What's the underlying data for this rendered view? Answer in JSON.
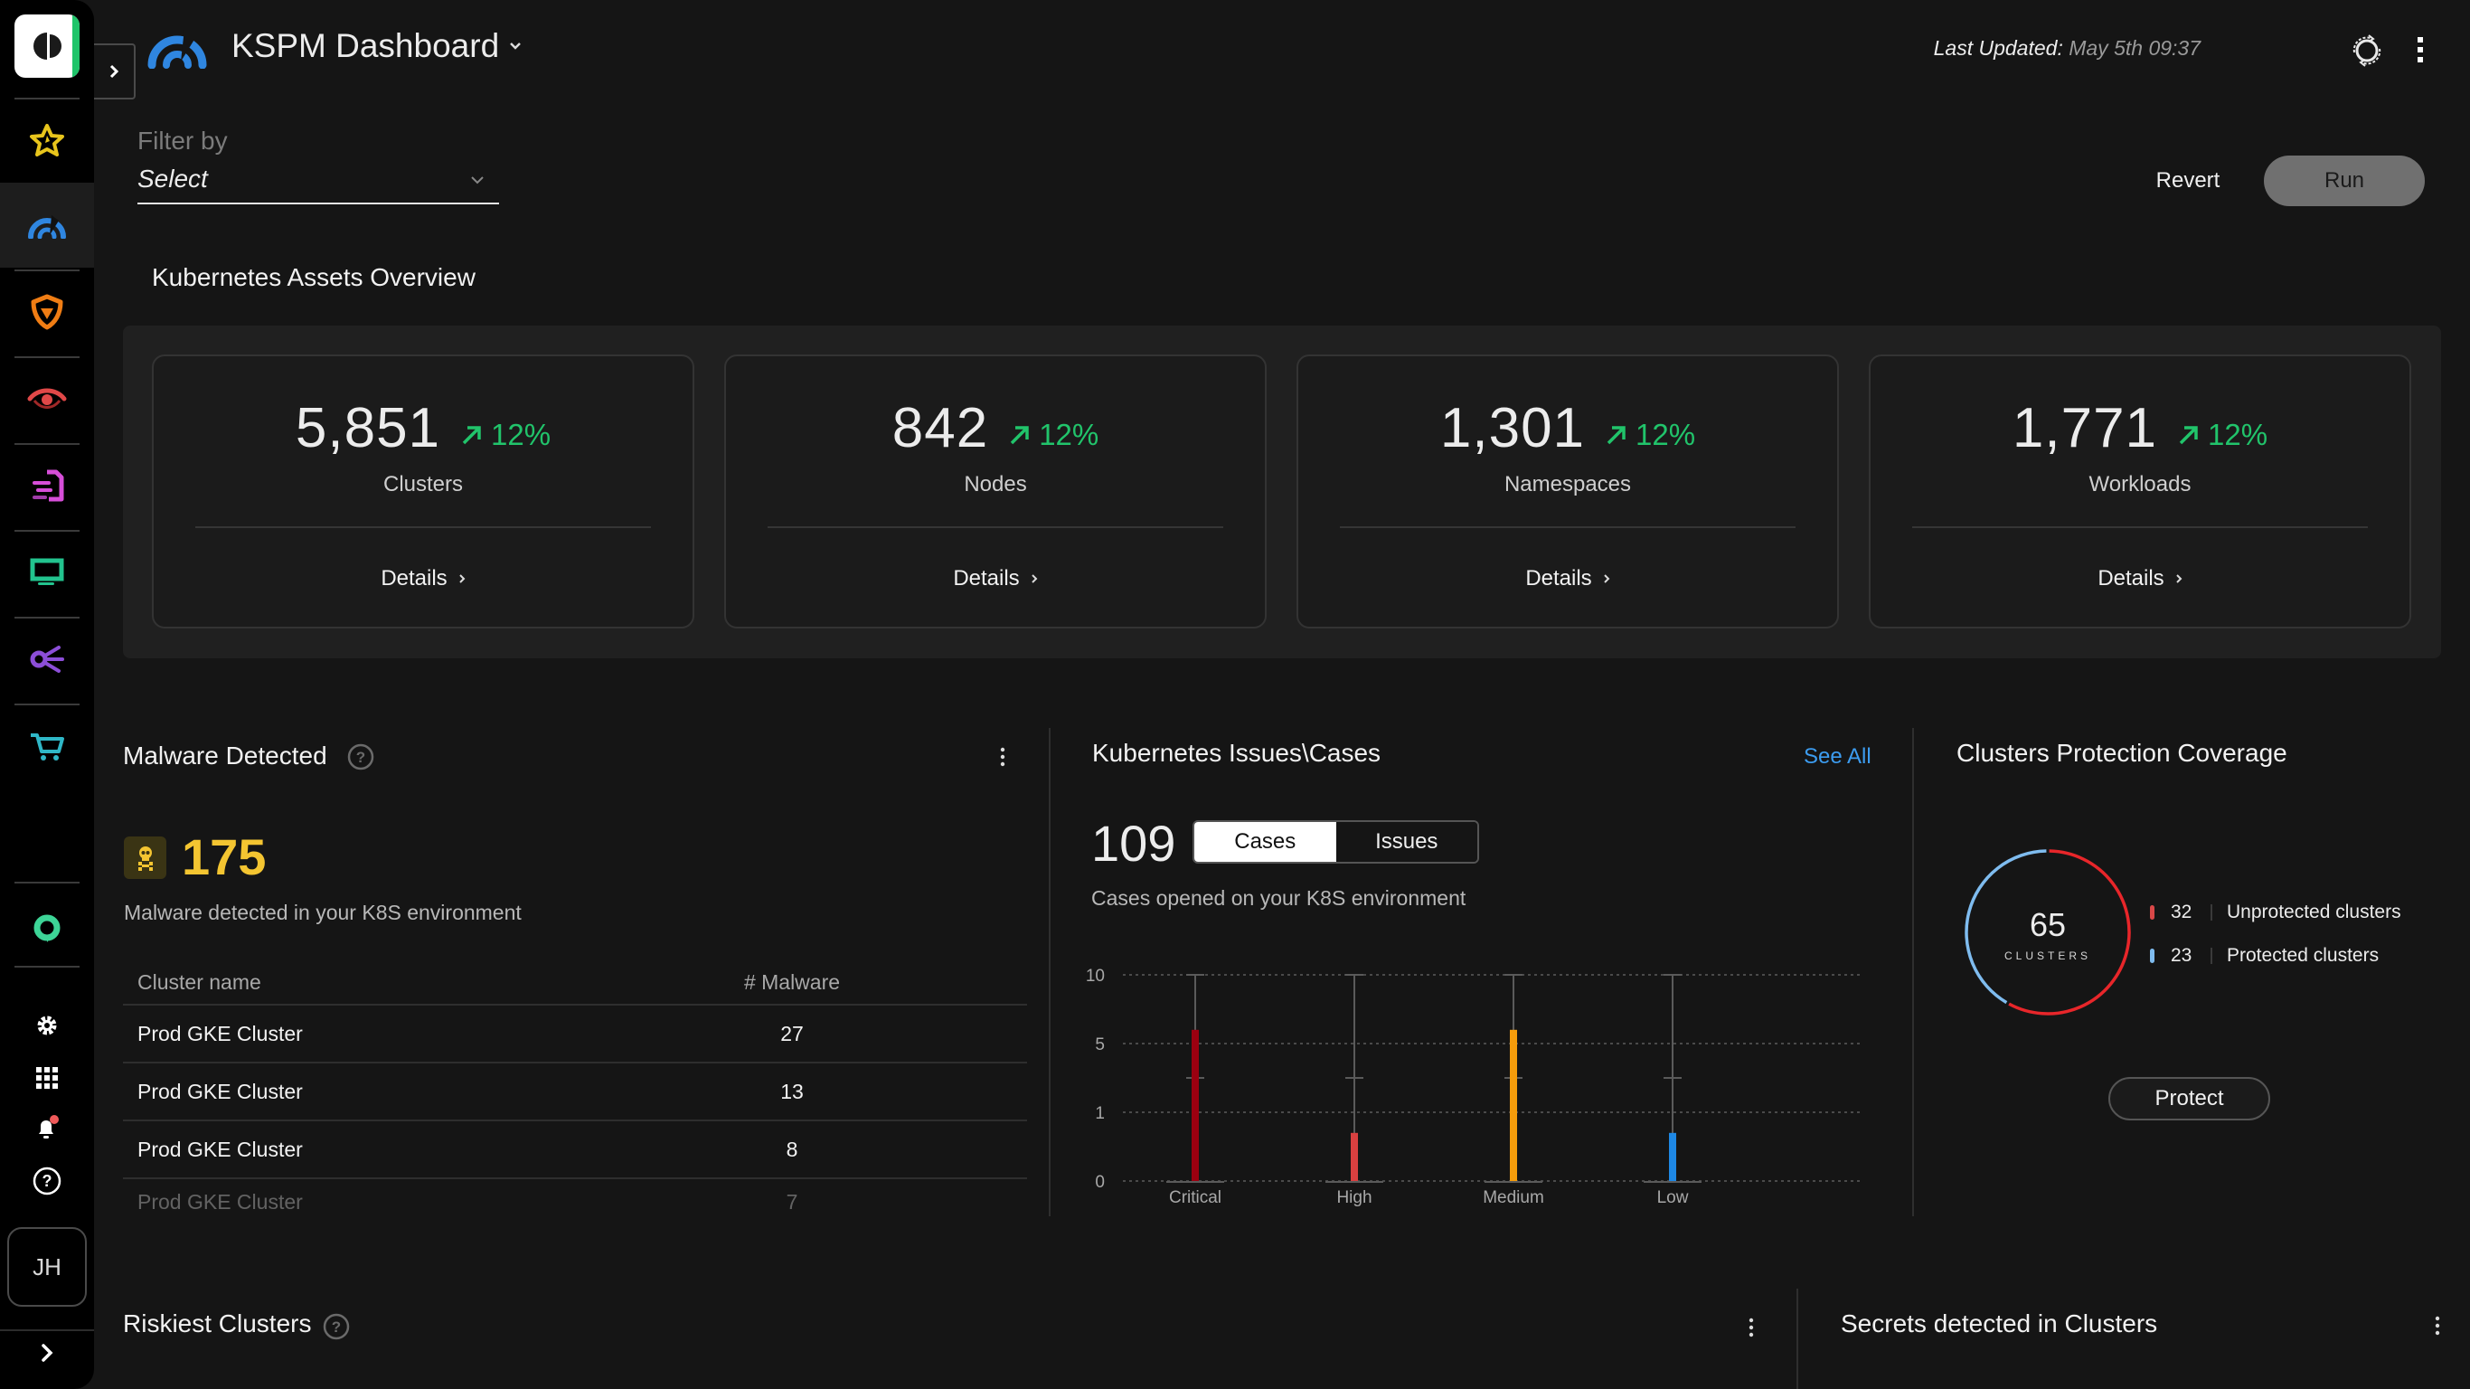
{
  "sidebar": {
    "items": [
      {
        "icon": "star-icon",
        "label": "Favorites",
        "color": "#e8c51c"
      },
      {
        "icon": "dashboard-gauge-icon",
        "label": "Dashboards",
        "color": "#2f86e0",
        "active": true
      },
      {
        "icon": "shield-icon",
        "label": "Protection",
        "color": "#f07d14"
      },
      {
        "icon": "eye-icon",
        "label": "Detection",
        "color": "#e04848"
      },
      {
        "icon": "document-icon",
        "label": "Reports",
        "color": "#d64ed8"
      },
      {
        "icon": "monitor-icon",
        "label": "Endpoints",
        "color": "#22c38e"
      },
      {
        "icon": "network-icon",
        "label": "Integrations",
        "color": "#8c4ed8"
      },
      {
        "icon": "cart-icon",
        "label": "Marketplace",
        "color": "#2fb7c7"
      }
    ],
    "avatar_initials": "JH"
  },
  "header": {
    "title": "KSPM Dashboard",
    "last_updated_label": "Last Updated:",
    "last_updated_value": "May 5th 09:37"
  },
  "filter": {
    "label": "Filter by",
    "value": "Select",
    "revert_label": "Revert",
    "run_label": "Run"
  },
  "assets": {
    "title": "Kubernetes Assets Overview",
    "cards": [
      {
        "value": "5,851",
        "trend": "12%",
        "label": "Clusters",
        "details": "Details"
      },
      {
        "value": "842",
        "trend": "12%",
        "label": "Nodes",
        "details": "Details"
      },
      {
        "value": "1,301",
        "trend": "12%",
        "label": "Namespaces",
        "details": "Details"
      },
      {
        "value": "1,771",
        "trend": "12%",
        "label": "Workloads",
        "details": "Details"
      }
    ]
  },
  "malware": {
    "title": "Malware Detected",
    "count": "175",
    "description": "Malware detected in your K8S environment",
    "columns": [
      "Cluster name",
      "# Malware"
    ],
    "rows": [
      {
        "name": "Prod GKE Cluster",
        "count": "27"
      },
      {
        "name": "Prod GKE Cluster",
        "count": "13"
      },
      {
        "name": "Prod GKE Cluster",
        "count": "8"
      },
      {
        "name": "Prod GKE Cluster",
        "count": "7"
      }
    ]
  },
  "issues": {
    "title": "Kubernetes Issues\\Cases",
    "see_all": "See All",
    "count": "109",
    "toggle": {
      "cases": "Cases",
      "issues": "Issues",
      "selected": "Cases"
    },
    "description": "Cases opened on your K8S environment"
  },
  "chart_data": {
    "type": "bar",
    "title": "Kubernetes Issues\\Cases",
    "xlabel": "",
    "ylabel": "",
    "categories": [
      "Critical",
      "High",
      "Medium",
      "Low"
    ],
    "values": [
      6,
      0.7,
      6,
      0.7
    ],
    "colors": [
      "#9b0010",
      "#d94040",
      "#f59c0b",
      "#1e88e5"
    ],
    "y_ticks": [
      0,
      1,
      5,
      10
    ],
    "y_scale": "piecewise (0,1,5,10 evenly spaced)",
    "ylim": [
      0,
      10
    ],
    "grid": true
  },
  "coverage": {
    "title": "Clusters Protection Coverage",
    "total": "65",
    "unit": "CLUSTERS",
    "segments": [
      {
        "label": "Unprotected clusters",
        "value": 32,
        "color": "#e8262a"
      },
      {
        "label": "Protected clusters",
        "value": 23,
        "color": "#7fbcef"
      }
    ],
    "protect_label": "Protect"
  },
  "riskiest": {
    "title": "Riskiest Clusters"
  },
  "secrets": {
    "title": "Secrets detected in Clusters"
  }
}
